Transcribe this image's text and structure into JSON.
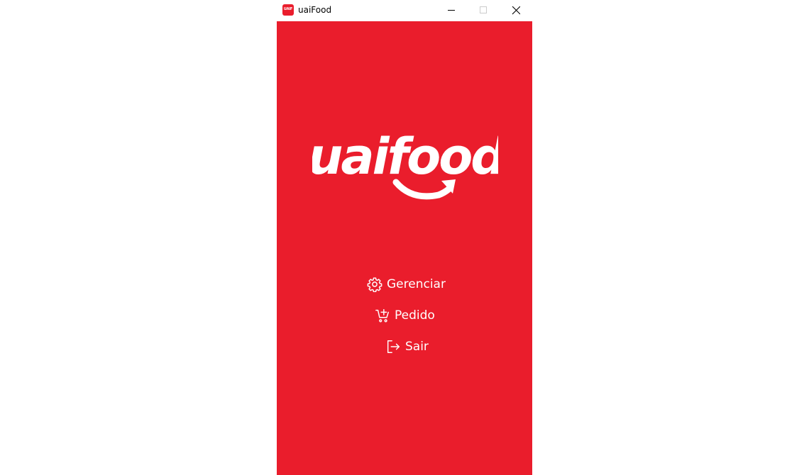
{
  "window": {
    "title": "uaiFood",
    "app_icon_text": "UAIF"
  },
  "brand": {
    "logo_text": "uaifood",
    "color": "#ea1d2c"
  },
  "menu": {
    "items": [
      {
        "label": "Gerenciar",
        "icon": "gear-icon"
      },
      {
        "label": "Pedido",
        "icon": "cart-add-icon"
      },
      {
        "label": "Sair",
        "icon": "logout-icon"
      }
    ]
  }
}
